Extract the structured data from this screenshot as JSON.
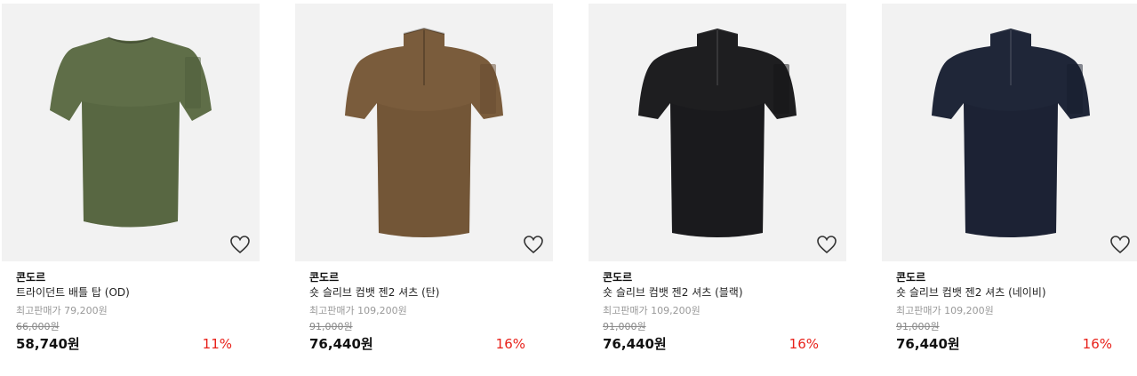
{
  "products": [
    {
      "brand": "콘도르",
      "name": "트라이던트 배틀 탑 (OD)",
      "ref_price": "최고판매가 79,200원",
      "original_price": "66,000원",
      "sale_price": "58,740원",
      "discount": "11%",
      "shirt_color": "#5f6e48",
      "shirt_shade": "#4d5b3a",
      "wishlist_icon": "heart-outline"
    },
    {
      "brand": "콘도르",
      "name": "숏 슬리브 컴뱃 젠2 셔츠 (탄)",
      "ref_price": "최고판매가 109,200원",
      "original_price": "91,000원",
      "sale_price": "76,440원",
      "discount": "16%",
      "shirt_color": "#7a5c3c",
      "shirt_shade": "#654a2f",
      "wishlist_icon": "heart-outline"
    },
    {
      "brand": "콘도르",
      "name": "숏 슬리브 컴뱃 젠2 셔츠 (블랙)",
      "ref_price": "최고판매가 109,200원",
      "original_price": "91,000원",
      "sale_price": "76,440원",
      "discount": "16%",
      "shirt_color": "#1e1e20",
      "shirt_shade": "#141416",
      "wishlist_icon": "heart-outline"
    },
    {
      "brand": "콘도르",
      "name": "숏 슬리브 컴뱃 젠2 셔츠 (네이비)",
      "ref_price": "최고판매가 109,200원",
      "original_price": "91,000원",
      "sale_price": "76,440원",
      "discount": "16%",
      "shirt_color": "#1f2638",
      "shirt_shade": "#161c2b",
      "wishlist_icon": "heart-outline"
    }
  ]
}
